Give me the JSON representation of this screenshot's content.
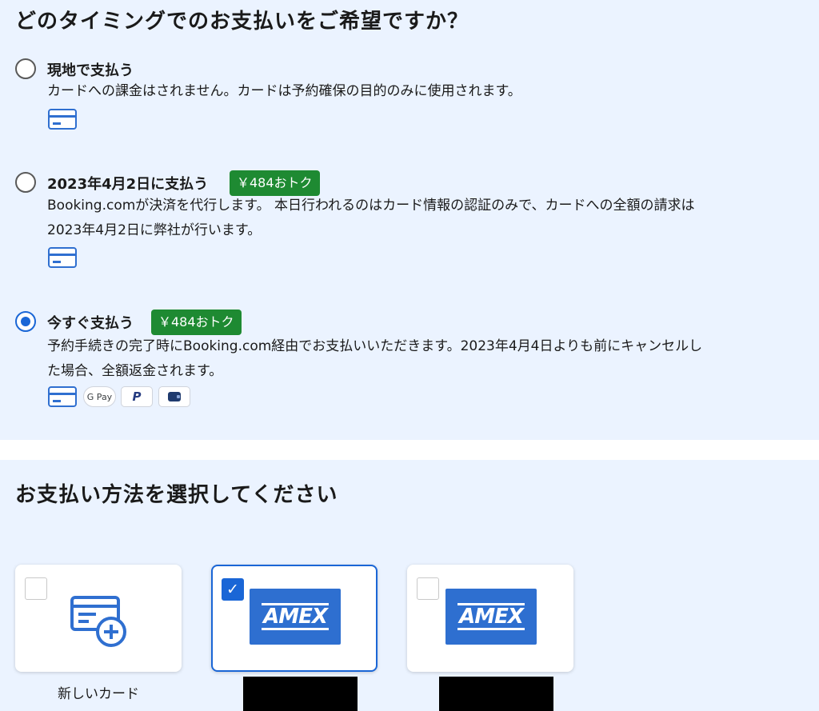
{
  "timing": {
    "title": "どのタイミングでのお支払いをご希望ですか？",
    "options": [
      {
        "title": "現地で支払う",
        "badge": "",
        "description": "カードへの課金はされません。カードは予約確保の目的のみに使用されます。",
        "selected": false,
        "payment_icons": [
          "credit-card-icon"
        ]
      },
      {
        "title": "2023年4月2日に支払う",
        "badge": "￥484おトク",
        "description_line1": "Booking.comが決済を代行します。 本日行われるのはカード情報の認証のみで、カードへの全額の請求は",
        "description_line2": "2023年4月2日に弊社が行います。",
        "selected": false,
        "payment_icons": [
          "credit-card-icon"
        ]
      },
      {
        "title": "今すぐ支払う",
        "badge": "￥484おトク",
        "description_line1": "予約手続きの完了時にBooking.com経由でお支払いいただきます。2023年4月4日よりも前にキャンセルし",
        "description_line2": "た場合、全額返金されます。",
        "selected": true,
        "payment_icons": [
          "credit-card-icon",
          "google-pay-icon",
          "paypal-icon",
          "wallet-icon"
        ],
        "gpay_label": "G Pay",
        "paypal_label": "P"
      }
    ]
  },
  "payment_method": {
    "title": "お支払い方法を選択してください",
    "cards": [
      {
        "type": "new-card",
        "label": "新しいカード",
        "checked": false
      },
      {
        "type": "amex",
        "logo_text": "AMEX",
        "checked": true
      },
      {
        "type": "amex",
        "logo_text": "AMEX",
        "checked": false
      }
    ],
    "check_mark": "✓"
  },
  "colors": {
    "accent": "#1a66d6",
    "badge_green": "#1e8a32",
    "panel_bg": "#ebf3ff",
    "amex_blue": "#2e6fd0"
  }
}
